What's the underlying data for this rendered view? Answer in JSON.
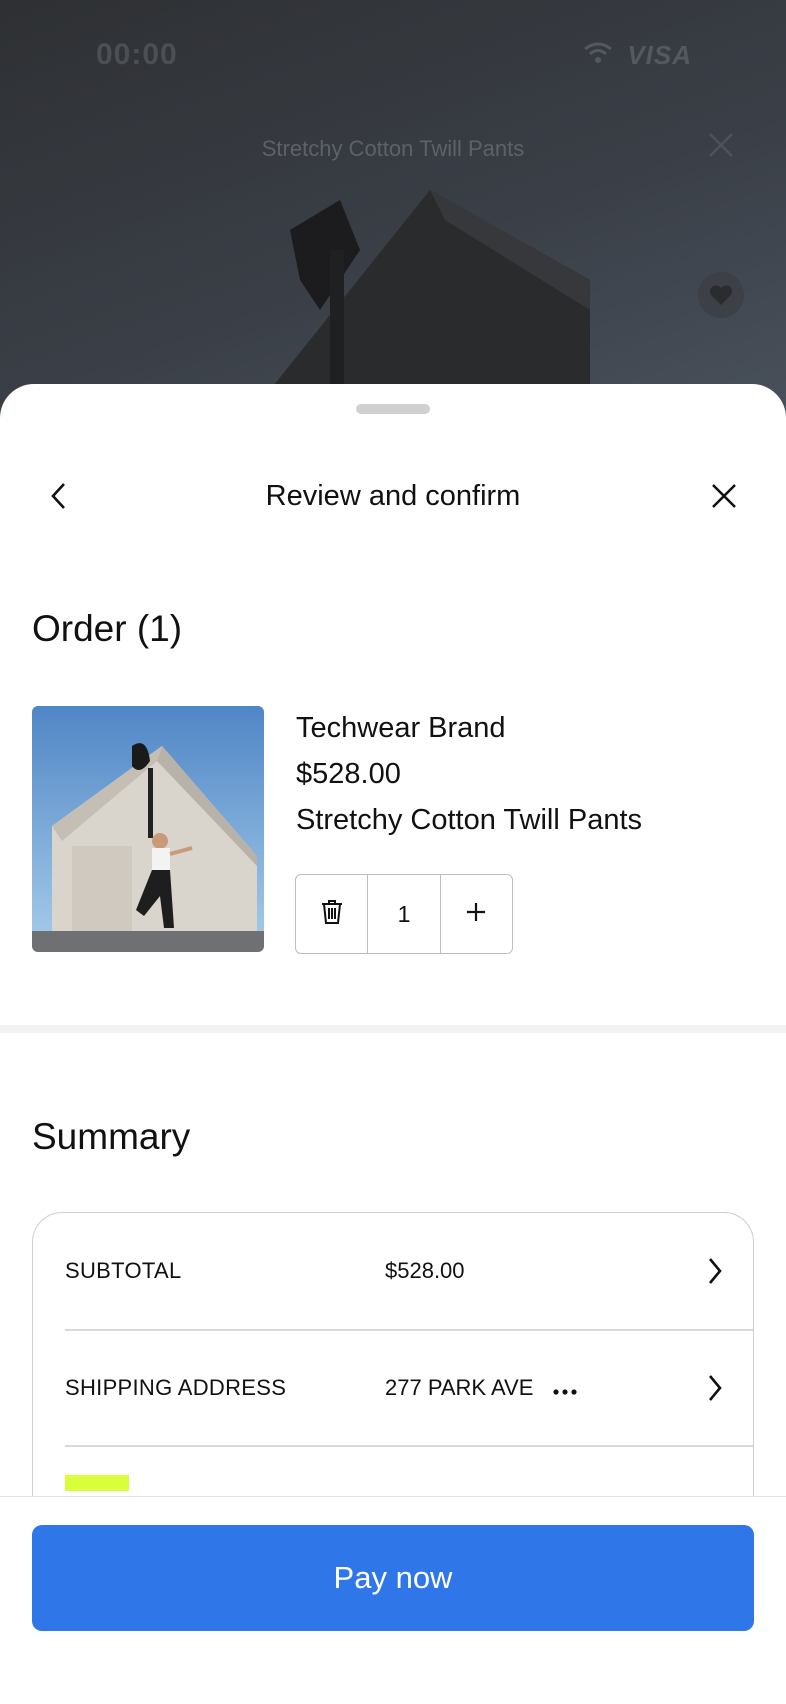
{
  "status_bar": {
    "time": "00:00",
    "card_brand": "VISA"
  },
  "background_page": {
    "title": "Stretchy Cotton Twill Pants"
  },
  "sheet": {
    "header_title": "Review and confirm"
  },
  "order": {
    "title": "Order (1)",
    "items": [
      {
        "brand": "Techwear Brand",
        "price": "$528.00",
        "name": "Stretchy Cotton Twill Pants",
        "quantity": "1"
      }
    ]
  },
  "summary": {
    "title": "Summary",
    "rows": [
      {
        "label": "SUBTOTAL",
        "value": "$528.00"
      },
      {
        "label": "SHIPPING ADDRESS",
        "value": "277 PARK AVE"
      }
    ]
  },
  "footer": {
    "pay_label": "Pay now"
  },
  "colors": {
    "primary": "#2f76e8",
    "highlight": "#d8ff3a"
  }
}
